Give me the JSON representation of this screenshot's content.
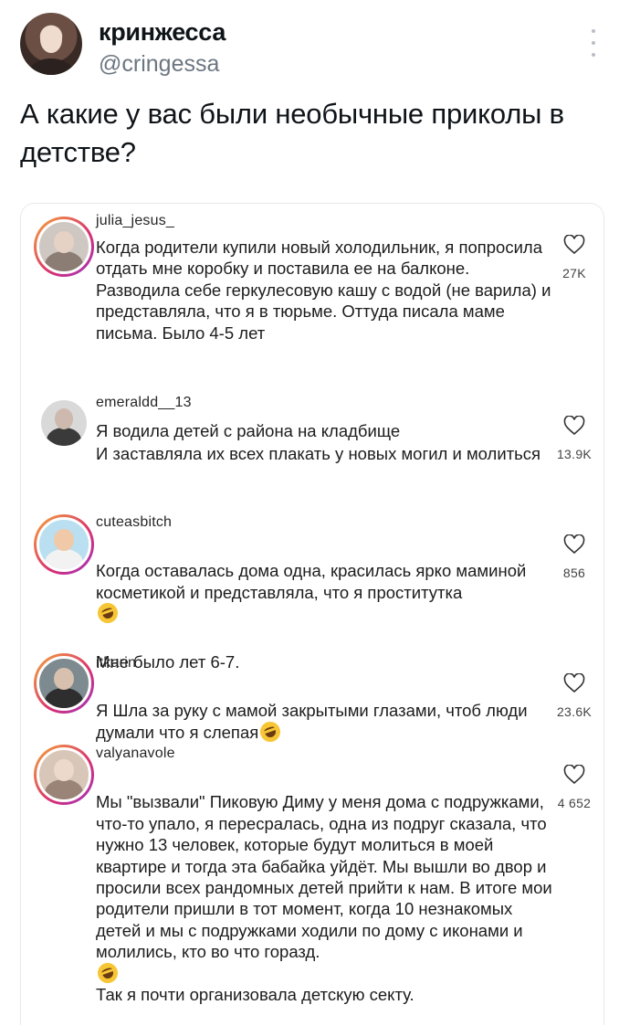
{
  "author": {
    "display_name": "кринжесса",
    "handle": "@cringessa"
  },
  "tweet_text": "А какие у вас были необычные приколы в детстве?",
  "comments": [
    {
      "username": "julia_jesus_",
      "text": "Когда родители купили новый холодильник, я попросила отдать мне коробку и поставила ее на балконе. Разводила себе геркулесовую кашу с водой (не варила) и представляла, что я в тюрьме. Оттуда писала маме письма. Было 4-5 лет",
      "likes": "27K"
    },
    {
      "username": "emeraldd__13",
      "text": "Я водила детей с района на кладбище\nИ заставляла их всех плакать у новых могил и молиться",
      "likes": "13.9K"
    },
    {
      "username": "cuteasbitch",
      "text_before": "Когда оставалась дома одна, красилась ярко маминой косметикой и представляла, что я проститутка",
      "text_after": "Мне было лет 6-7.",
      "likes": "856"
    },
    {
      "username": "itkarin",
      "text_before": "Я Шла за руку с мамой закрытыми глазами, чтоб люди думали что я слепая",
      "likes": "23.6K"
    },
    {
      "username": "valyanavole",
      "text_before": "Мы \"вызвали\" Пиковую Диму у меня дома с подружками, что-то упало, я пересралась, одна из подруг сказала, что нужно 13 человек, которые будут молиться в моей квартире и тогда эта бабайка уйдёт. Мы вышли во двор и просили всех рандомных детей прийти к нам. В итоге мои родители пришли в тот момент, когда 10 незнакомых детей и мы с подружками ходили по дому с иконами и молились, кто во что горазд.",
      "text_after": "Так я почти организовала детскую секту.",
      "likes": "4 652"
    }
  ],
  "icons": {
    "heart": "heart-icon",
    "emoji": "rolling-laughing-emoji-icon",
    "more": "more-vertical-icon"
  },
  "colors": {
    "text_primary": "#0f1419",
    "text_secondary": "#6c7681",
    "story_ring_start": "#f4a93a",
    "story_ring_end": "#9b36c6",
    "emoji_yellow": "#f7c635"
  }
}
